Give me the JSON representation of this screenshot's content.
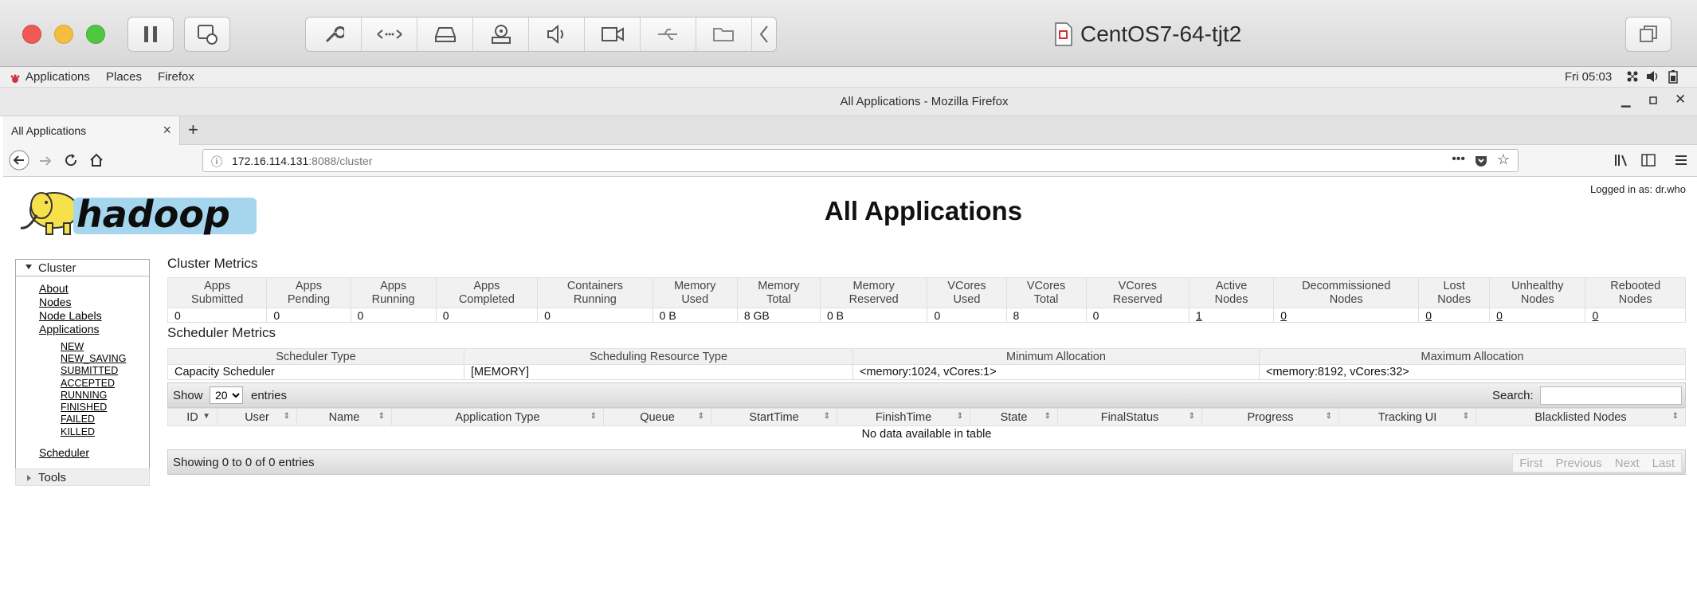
{
  "vm": {
    "title": "CentOS7-64-tjt2"
  },
  "gnome": {
    "applications": "Applications",
    "places": "Places",
    "firefox": "Firefox",
    "clock": "Fri 05:03"
  },
  "firefox": {
    "window_title": "All Applications - Mozilla Firefox",
    "tab_title": "All Applications",
    "url_host": "172.16.114.131",
    "url_rest": ":8088/cluster"
  },
  "page": {
    "title": "All Applications",
    "logged_in": "Logged in as: dr.who"
  },
  "sidebar": {
    "cluster": "Cluster",
    "links": [
      "About",
      "Nodes",
      "Node Labels",
      "Applications"
    ],
    "states": [
      "NEW",
      "NEW_SAVING",
      "SUBMITTED",
      "ACCEPTED",
      "RUNNING",
      "FINISHED",
      "FAILED",
      "KILLED"
    ],
    "scheduler": "Scheduler",
    "tools": "Tools"
  },
  "cluster_metrics": {
    "title": "Cluster Metrics",
    "headers": [
      [
        "Apps",
        "Submitted"
      ],
      [
        "Apps",
        "Pending"
      ],
      [
        "Apps",
        "Running"
      ],
      [
        "Apps",
        "Completed"
      ],
      [
        "Containers",
        "Running"
      ],
      [
        "Memory",
        "Used"
      ],
      [
        "Memory",
        "Total"
      ],
      [
        "Memory",
        "Reserved"
      ],
      [
        "VCores",
        "Used"
      ],
      [
        "VCores",
        "Total"
      ],
      [
        "VCores",
        "Reserved"
      ],
      [
        "Active",
        "Nodes"
      ],
      [
        "Decommissioned",
        "Nodes"
      ],
      [
        "Lost",
        "Nodes"
      ],
      [
        "Unhealthy",
        "Nodes"
      ],
      [
        "Rebooted",
        "Nodes"
      ]
    ],
    "values": [
      "0",
      "0",
      "0",
      "0",
      "0",
      "0 B",
      "8 GB",
      "0 B",
      "0",
      "8",
      "0",
      "1",
      "0",
      "0",
      "0",
      "0"
    ]
  },
  "scheduler_metrics": {
    "title": "Scheduler Metrics",
    "headers": [
      "Scheduler Type",
      "Scheduling Resource Type",
      "Minimum Allocation",
      "Maximum Allocation"
    ],
    "values": [
      "Capacity Scheduler",
      "[MEMORY]",
      "<memory:1024, vCores:1>",
      "<memory:8192, vCores:32>"
    ]
  },
  "apps_table": {
    "show": "Show",
    "page_size": "20",
    "entries": "entries",
    "search_label": "Search:",
    "headers": [
      "ID",
      "User",
      "Name",
      "Application Type",
      "Queue",
      "StartTime",
      "FinishTime",
      "State",
      "FinalStatus",
      "Progress",
      "Tracking UI",
      "Blacklisted Nodes"
    ],
    "empty": "No data available in table",
    "info": "Showing 0 to 0 of 0 entries",
    "pager": [
      "First",
      "Previous",
      "Next",
      "Last"
    ]
  },
  "colors": {
    "close": "#ee5b55",
    "minimize": "#f5bd3f",
    "maximize": "#4fc740"
  }
}
